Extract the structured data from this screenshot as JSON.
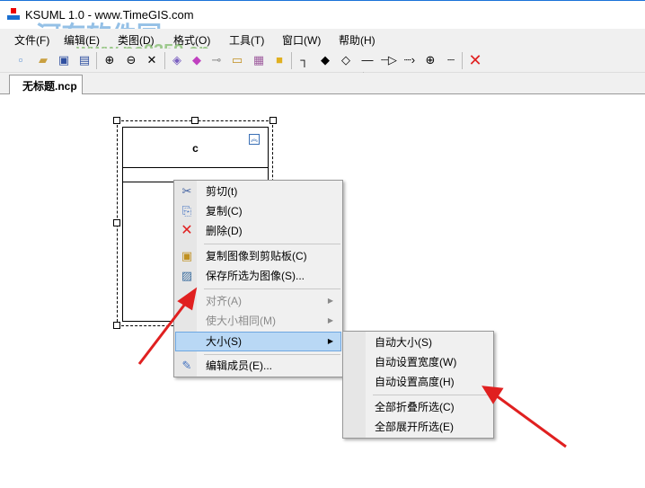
{
  "window": {
    "title": "KSUML 1.0 - www.TimeGIS.com"
  },
  "watermark": {
    "name": "河东软件园",
    "url": "www.pc0359.cn"
  },
  "menubar": [
    "文件(F)",
    "编辑(E)",
    "类图(D)",
    "格式(O)",
    "工具(T)",
    "窗口(W)",
    "帮助(H)"
  ],
  "toolbar": {
    "icons": [
      "new-icon",
      "open-icon",
      "save-icon",
      "save-all-icon",
      "zoom-in-icon",
      "zoom-out-icon",
      "fit-icon",
      "class-icon",
      "interface-icon",
      "link-icon",
      "package-icon",
      "component-icon",
      "note-icon",
      "orthogonal-line-icon",
      "composition-icon",
      "aggregation-icon",
      "generalization-icon",
      "realization-icon",
      "dependency-icon",
      "nesting-icon",
      "dashed-line-icon",
      "delete-icon"
    ]
  },
  "tab": {
    "label": "无标题.ncp"
  },
  "class_box": {
    "name": "c"
  },
  "context_menu": {
    "items": [
      {
        "label": "剪切(t)",
        "icon": "scissors-icon"
      },
      {
        "label": "复制(C)",
        "icon": "copy-icon"
      },
      {
        "label": "删除(D)",
        "icon": "delete-icon"
      },
      {
        "label": "复制图像到剪贴板(C)",
        "icon": "clipboard-image-icon"
      },
      {
        "label": "保存所选为图像(S)...",
        "icon": "image-icon"
      },
      {
        "label": "对齐(A)",
        "disabled": true
      },
      {
        "label": "使大小相同(M)",
        "disabled": true
      },
      {
        "label": "大小(S)",
        "highlighted": true
      },
      {
        "label": "编辑成员(E)...",
        "icon": "edit-icon"
      }
    ]
  },
  "submenu": {
    "items": [
      "自动大小(S)",
      "自动设置宽度(W)",
      "自动设置高度(H)",
      "全部折叠所选(C)",
      "全部展开所选(E)"
    ]
  },
  "colors": {
    "highlight": "#b9d8f5",
    "arrow": "#e02020"
  }
}
